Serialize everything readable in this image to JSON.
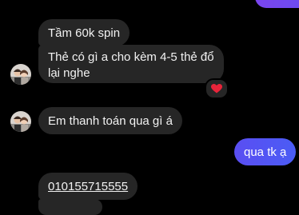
{
  "colors": {
    "background": "#000000",
    "received_bubble": "#262626",
    "sent_bubble_gradient": [
      "#6a4cf0",
      "#4b5cf5"
    ],
    "reaction_heart": "#e8243a"
  },
  "messages": [
    {
      "side": "received",
      "text": "Tầm 60k spin"
    },
    {
      "side": "received",
      "lines": [
        "Thẻ có gì a cho kèm 4-5 thẻ đổ",
        "lại nghe"
      ],
      "reaction": "heart-icon"
    },
    {
      "side": "received",
      "text": "Em thanh toán qua gì á"
    },
    {
      "side": "sent",
      "text": "qua tk ạ"
    },
    {
      "side": "received",
      "text": "010155715555",
      "underlined": true
    }
  ]
}
